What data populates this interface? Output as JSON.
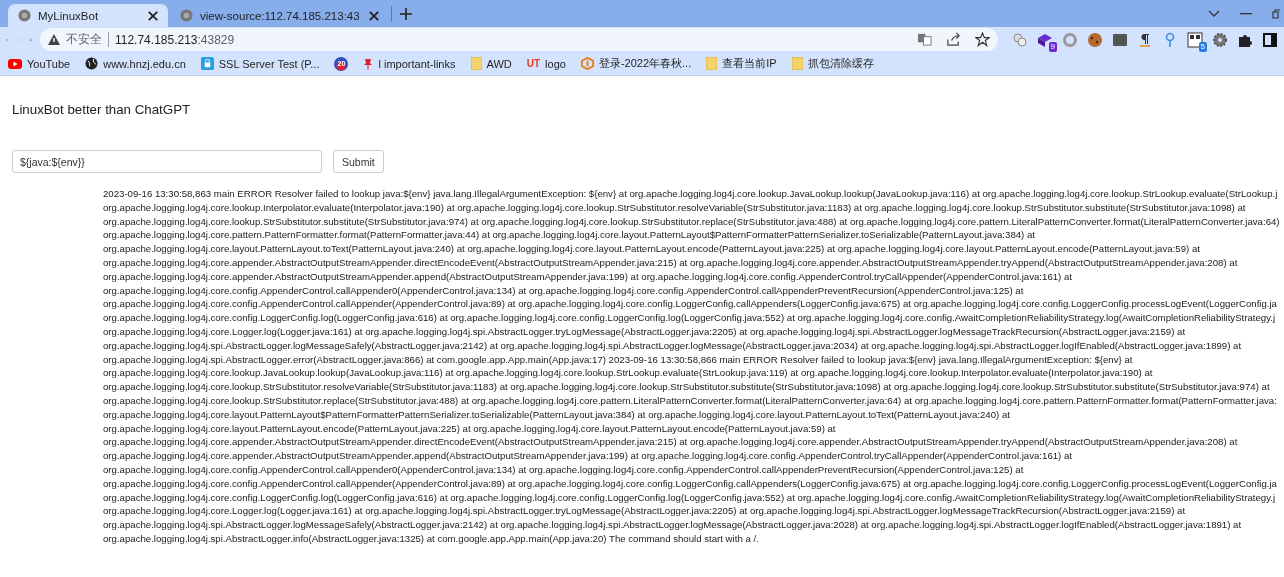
{
  "tabs": [
    {
      "title": "MyLinuxBot",
      "selected": true
    },
    {
      "title": "view-source:112.74.185.213:43",
      "selected": false
    }
  ],
  "address_bar": {
    "security_label": "不安全",
    "host": "112.74.185.213",
    "port": ":43829"
  },
  "extensions": [
    {
      "kind": "bubbles"
    },
    {
      "kind": "cube",
      "badge": "9"
    },
    {
      "kind": "ring"
    },
    {
      "kind": "cookie"
    },
    {
      "kind": "off"
    },
    {
      "kind": "pilcrow"
    },
    {
      "kind": "pin"
    },
    {
      "kind": "qr",
      "badge": "5"
    },
    {
      "kind": "gear"
    },
    {
      "kind": "puzzle"
    },
    {
      "kind": "sidepanel"
    }
  ],
  "bookmarks": [
    {
      "kind": "youtube",
      "label": "YouTube"
    },
    {
      "kind": "globe",
      "label": "www.hnzj.edu.cn"
    },
    {
      "kind": "lock",
      "label": "SSL Server Test (P..."
    },
    {
      "kind": "counter",
      "badge": "20"
    },
    {
      "kind": "pin",
      "label": "l important-links"
    },
    {
      "kind": "folder",
      "label": "AWD"
    },
    {
      "kind": "logo",
      "logo_text": "UT",
      "label": "logo"
    },
    {
      "kind": "orange",
      "label": "登录-2022年春秋..."
    },
    {
      "kind": "folder",
      "label": "查看当前IP"
    },
    {
      "kind": "folder",
      "label": "抓包清除缓存"
    }
  ],
  "page": {
    "heading": "LinuxBot better than ChatGPT",
    "command_input": {
      "value": "${java:${env}}"
    },
    "submit_button": "Submit",
    "log_lines": [
      "2023-09-16 13:30:58,863 main ERROR Resolver failed to lookup java:${env} java.lang.IllegalArgumentException: ${env} at org.apache.logging.log4j.core.lookup.JavaLookup.lookup(JavaLookup.java:116) at org.apache.logging.log4j.core.lookup.StrLookup.evaluate(StrLookup.j",
      "org.apache.logging.log4j.core.lookup.Interpolator.evaluate(Interpolator.java:190) at org.apache.logging.log4j.core.lookup.StrSubstitutor.resolveVariable(StrSubstitutor.java:1183) at org.apache.logging.log4j.core.lookup.StrSubstitutor.substitute(StrSubstitutor.java:1098) at",
      "org.apache.logging.log4j.core.lookup.StrSubstitutor.substitute(StrSubstitutor.java:974) at org.apache.logging.log4j.core.lookup.StrSubstitutor.replace(StrSubstitutor.java:488) at org.apache.logging.log4j.core.pattern.LiteralPatternConverter.format(LiteralPatternConverter.java:64)",
      "org.apache.logging.log4j.core.pattern.PatternFormatter.format(PatternFormatter.java:44) at org.apache.logging.log4j.core.layout.PatternLayout$PatternFormatterPatternSerializer.toSerializable(PatternLayout.java:384) at",
      "org.apache.logging.log4j.core.layout.PatternLayout.toText(PatternLayout.java:240) at org.apache.logging.log4j.core.layout.PatternLayout.encode(PatternLayout.java:225) at org.apache.logging.log4j.core.layout.PatternLayout.encode(PatternLayout.java:59) at",
      "org.apache.logging.log4j.core.appender.AbstractOutputStreamAppender.directEncodeEvent(AbstractOutputStreamAppender.java:215) at org.apache.logging.log4j.core.appender.AbstractOutputStreamAppender.tryAppend(AbstractOutputStreamAppender.java:208) at",
      "org.apache.logging.log4j.core.appender.AbstractOutputStreamAppender.append(AbstractOutputStreamAppender.java:199) at org.apache.logging.log4j.core.config.AppenderControl.tryCallAppender(AppenderControl.java:161) at",
      "org.apache.logging.log4j.core.config.AppenderControl.callAppender0(AppenderControl.java:134) at org.apache.logging.log4j.core.config.AppenderControl.callAppenderPreventRecursion(AppenderControl.java:125) at",
      "org.apache.logging.log4j.core.config.AppenderControl.callAppender(AppenderControl.java:89) at org.apache.logging.log4j.core.config.LoggerConfig.callAppenders(LoggerConfig.java:675) at org.apache.logging.log4j.core.config.LoggerConfig.processLogEvent(LoggerConfig.ja",
      "org.apache.logging.log4j.core.config.LoggerConfig.log(LoggerConfig.java:616) at org.apache.logging.log4j.core.config.LoggerConfig.log(LoggerConfig.java:552) at org.apache.logging.log4j.core.config.AwaitCompletionReliabilityStrategy.log(AwaitCompletionReliabilityStrategy.j",
      "org.apache.logging.log4j.core.Logger.log(Logger.java:161) at org.apache.logging.log4j.spi.AbstractLogger.tryLogMessage(AbstractLogger.java:2205) at org.apache.logging.log4j.spi.AbstractLogger.logMessageTrackRecursion(AbstractLogger.java:2159) at",
      "org.apache.logging.log4j.spi.AbstractLogger.logMessageSafely(AbstractLogger.java:2142) at org.apache.logging.log4j.spi.AbstractLogger.logMessage(AbstractLogger.java:2034) at org.apache.logging.log4j.spi.AbstractLogger.logIfEnabled(AbstractLogger.java:1899) at",
      "org.apache.logging.log4j.spi.AbstractLogger.error(AbstractLogger.java:866) at com.google.app.App.main(App.java:17) 2023-09-16 13:30:58,866 main ERROR Resolver failed to lookup java:${env} java.lang.IllegalArgumentException: ${env} at",
      "org.apache.logging.log4j.core.lookup.JavaLookup.lookup(JavaLookup.java:116) at org.apache.logging.log4j.core.lookup.StrLookup.evaluate(StrLookup.java:119) at org.apache.logging.log4j.core.lookup.Interpolator.evaluate(Interpolator.java:190) at",
      "org.apache.logging.log4j.core.lookup.StrSubstitutor.resolveVariable(StrSubstitutor.java:1183) at org.apache.logging.log4j.core.lookup.StrSubstitutor.substitute(StrSubstitutor.java:1098) at org.apache.logging.log4j.core.lookup.StrSubstitutor.substitute(StrSubstitutor.java:974) at",
      "org.apache.logging.log4j.core.lookup.StrSubstitutor.replace(StrSubstitutor.java:488) at org.apache.logging.log4j.core.pattern.LiteralPatternConverter.format(LiteralPatternConverter.java:64) at org.apache.logging.log4j.core.pattern.PatternFormatter.format(PatternFormatter.java:",
      "org.apache.logging.log4j.core.layout.PatternLayout$PatternFormatterPatternSerializer.toSerializable(PatternLayout.java:384) at org.apache.logging.log4j.core.layout.PatternLayout.toText(PatternLayout.java:240) at",
      "org.apache.logging.log4j.core.layout.PatternLayout.encode(PatternLayout.java:225) at org.apache.logging.log4j.core.layout.PatternLayout.encode(PatternLayout.java:59) at",
      "org.apache.logging.log4j.core.appender.AbstractOutputStreamAppender.directEncodeEvent(AbstractOutputStreamAppender.java:215) at org.apache.logging.log4j.core.appender.AbstractOutputStreamAppender.tryAppend(AbstractOutputStreamAppender.java:208) at",
      "org.apache.logging.log4j.core.appender.AbstractOutputStreamAppender.append(AbstractOutputStreamAppender.java:199) at org.apache.logging.log4j.core.config.AppenderControl.tryCallAppender(AppenderControl.java:161) at",
      "org.apache.logging.log4j.core.config.AppenderControl.callAppender0(AppenderControl.java:134) at org.apache.logging.log4j.core.config.AppenderControl.callAppenderPreventRecursion(AppenderControl.java:125) at",
      "org.apache.logging.log4j.core.config.AppenderControl.callAppender(AppenderControl.java:89) at org.apache.logging.log4j.core.config.LoggerConfig.callAppenders(LoggerConfig.java:675) at org.apache.logging.log4j.core.config.LoggerConfig.processLogEvent(LoggerConfig.ja",
      "org.apache.logging.log4j.core.config.LoggerConfig.log(LoggerConfig.java:616) at org.apache.logging.log4j.core.config.LoggerConfig.log(LoggerConfig.java:552) at org.apache.logging.log4j.core.config.AwaitCompletionReliabilityStrategy.log(AwaitCompletionReliabilityStrategy.j",
      "org.apache.logging.log4j.core.Logger.log(Logger.java:161) at org.apache.logging.log4j.spi.AbstractLogger.tryLogMessage(AbstractLogger.java:2205) at org.apache.logging.log4j.spi.AbstractLogger.logMessageTrackRecursion(AbstractLogger.java:2159) at",
      "org.apache.logging.log4j.spi.AbstractLogger.logMessageSafely(AbstractLogger.java:2142) at org.apache.logging.log4j.spi.AbstractLogger.logMessage(AbstractLogger.java:2028) at org.apache.logging.log4j.spi.AbstractLogger.logIfEnabled(AbstractLogger.java:1891) at",
      "org.apache.logging.log4j.spi.AbstractLogger.info(AbstractLogger.java:1325) at com.google.app.App.main(App.java:20) The command should start with a /."
    ]
  }
}
